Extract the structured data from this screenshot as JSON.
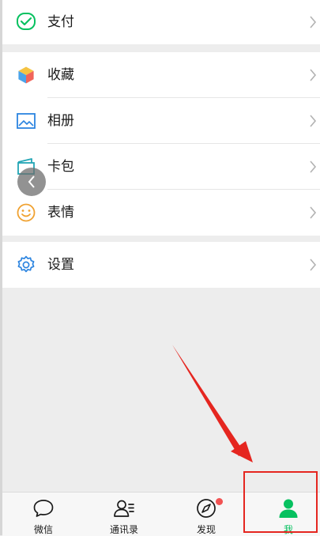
{
  "menu": {
    "pay": {
      "label": "支付"
    },
    "favorites": {
      "label": "收藏"
    },
    "album": {
      "label": "相册"
    },
    "cards": {
      "label": "卡包"
    },
    "stickers": {
      "label": "表情"
    },
    "settings": {
      "label": "设置"
    }
  },
  "tabbar": {
    "tabs": [
      {
        "label": "微信"
      },
      {
        "label": "通讯录"
      },
      {
        "label": "发现"
      },
      {
        "label": "我"
      }
    ],
    "active_index": 3
  },
  "colors": {
    "accent": "#07c160",
    "badge": "#f25353",
    "annotation": "#e52620"
  },
  "icons": [
    "pay-icon",
    "favorites-icon",
    "album-icon",
    "cards-icon",
    "sticker-icon",
    "gear-icon",
    "chevron-right-icon",
    "chevron-left-icon",
    "chat-icon",
    "contacts-icon",
    "compass-icon",
    "person-icon"
  ]
}
